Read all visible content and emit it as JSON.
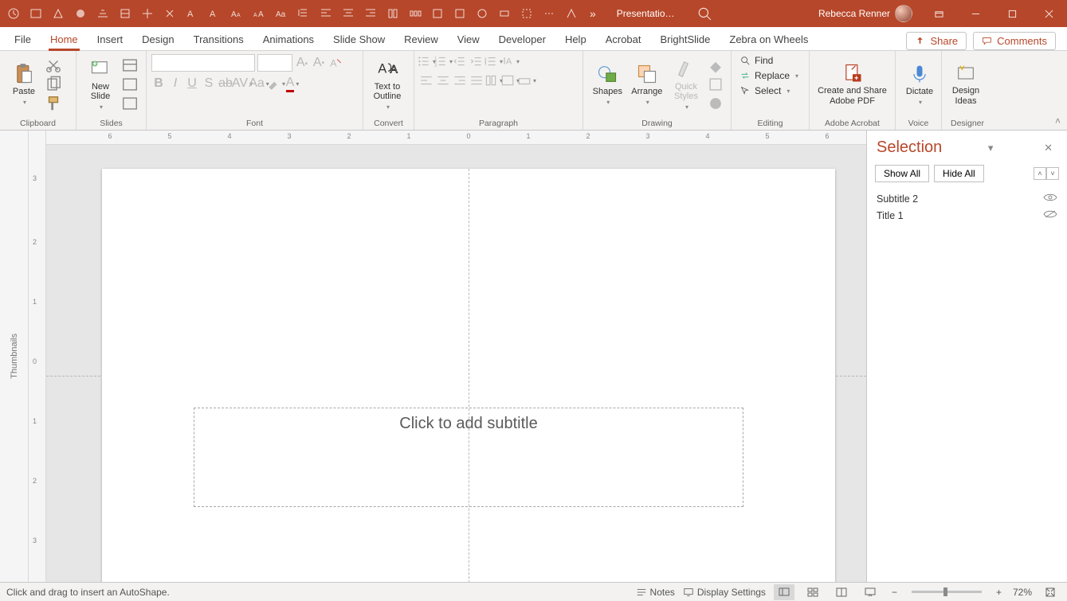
{
  "title": "Presentatio…",
  "user": "Rebecca Renner",
  "tabs": [
    "File",
    "Home",
    "Insert",
    "Design",
    "Transitions",
    "Animations",
    "Slide Show",
    "Review",
    "View",
    "Developer",
    "Help",
    "Acrobat",
    "BrightSlide",
    "Zebra on Wheels"
  ],
  "active_tab": 1,
  "share_label": "Share",
  "comments_label": "Comments",
  "ribbon_groups": {
    "clipboard": {
      "label": "Clipboard",
      "paste": "Paste"
    },
    "slides": {
      "label": "Slides",
      "new_slide": "New\nSlide"
    },
    "font": {
      "label": "Font"
    },
    "convert": {
      "label": "Convert",
      "text_to_outline": "Text to\nOutline"
    },
    "paragraph": {
      "label": "Paragraph"
    },
    "drawing": {
      "label": "Drawing",
      "shapes": "Shapes",
      "arrange": "Arrange",
      "quick_styles": "Quick\nStyles"
    },
    "editing": {
      "label": "Editing",
      "find": "Find",
      "replace": "Replace",
      "select": "Select"
    },
    "adobe": {
      "label": "Adobe Acrobat",
      "btn": "Create and Share\nAdobe PDF"
    },
    "voice": {
      "label": "Voice",
      "dictate": "Dictate"
    },
    "designer": {
      "label": "Designer",
      "ideas": "Design\nIdeas"
    }
  },
  "thumbnails_label": "Thumbnails",
  "slide": {
    "subtitle_placeholder": "Click to add subtitle"
  },
  "selection_pane": {
    "title": "Selection",
    "show_all": "Show All",
    "hide_all": "Hide All",
    "items": [
      {
        "name": "Subtitle 2",
        "visible": true
      },
      {
        "name": "Title 1",
        "visible": false
      }
    ]
  },
  "status": {
    "msg": "Click and drag to insert an AutoShape.",
    "notes": "Notes",
    "display": "Display Settings",
    "zoom": "72%"
  },
  "ruler_h": [
    "6",
    "5",
    "4",
    "3",
    "2",
    "1",
    "0",
    "1",
    "2",
    "3",
    "4",
    "5",
    "6"
  ],
  "ruler_v": [
    "3",
    "2",
    "1",
    "0",
    "1",
    "2",
    "3"
  ]
}
